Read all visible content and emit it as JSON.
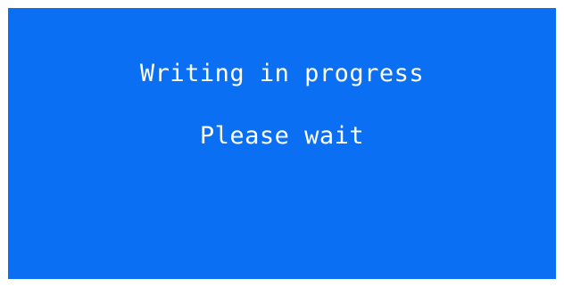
{
  "dialog": {
    "message_line1": "Writing in progress",
    "message_line2": "Please wait"
  },
  "colors": {
    "background": "#0a6ff2",
    "text": "#ffffff"
  }
}
